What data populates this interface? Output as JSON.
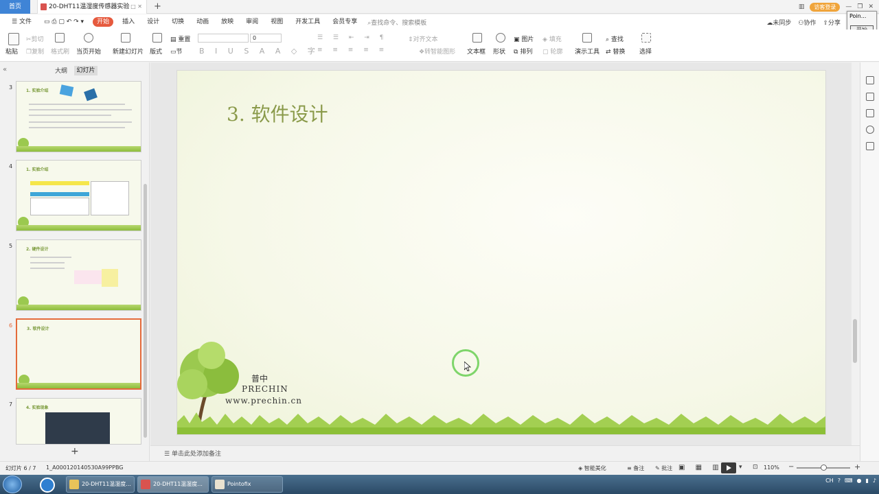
{
  "titlebar": {
    "home_tab": "首页",
    "doc_tab": "20-DHT11温湿度传感器实验",
    "new_tab": "+",
    "visitor_login": "访客登录"
  },
  "menu": {
    "file": "文件",
    "items": [
      "开始",
      "插入",
      "设计",
      "切换",
      "动画",
      "放映",
      "审阅",
      "视图",
      "开发工具",
      "会员专享"
    ],
    "active": "开始",
    "search_placeholder": "查找命令、搜索模板",
    "sync": "未同步",
    "collab": "协作",
    "share": "分享"
  },
  "pointofix": {
    "title": "Poin...",
    "button": "开始"
  },
  "ribbon": {
    "paste": "粘贴",
    "cut": "剪切",
    "copy": "复制",
    "format_painter": "格式刷",
    "start_from_current": "当页开始",
    "new_slide": "新建幻灯片",
    "layout": "版式",
    "section": "节",
    "reset": "重置",
    "font_size": "0",
    "align_text": "对齐文本",
    "convert_smartart": "转智能图形",
    "textbox": "文本框",
    "shape": "形状",
    "picture": "图片",
    "fill": "填充",
    "arrange": "排列",
    "outline": "轮廓",
    "present_tools": "演示工具",
    "find": "查找",
    "replace": "替换",
    "select": "选择"
  },
  "leftpanel": {
    "outline_tab": "大纲",
    "slides_tab": "幻灯片",
    "thumbs": [
      {
        "num": "3",
        "title": "1. 实验介绍"
      },
      {
        "num": "4",
        "title": "1. 实验介绍"
      },
      {
        "num": "5",
        "title": "2. 硬件设计"
      },
      {
        "num": "6",
        "title": "3. 软件设计"
      },
      {
        "num": "7",
        "title": "4. 实验现象"
      }
    ],
    "selected_index": 3
  },
  "slide": {
    "title": "3. 软件设计",
    "logo_cn": "普中",
    "logo_en": "PRECHIN",
    "logo_url": "www.prechin.cn"
  },
  "notes_placeholder": "单击此处添加备注",
  "status": {
    "slide_counter": "幻灯片 6 / 7",
    "theme_id": "1_A000120140530A99PPBG",
    "smart_beautify": "智能美化",
    "notes": "备注",
    "comments": "批注",
    "zoom": "110%",
    "zoom_level": 0.5
  },
  "taskbar": {
    "items": [
      "20-DHT11温湿度...",
      "20-DHT11温湿度...",
      "Pointofix"
    ],
    "lang": "CH"
  }
}
